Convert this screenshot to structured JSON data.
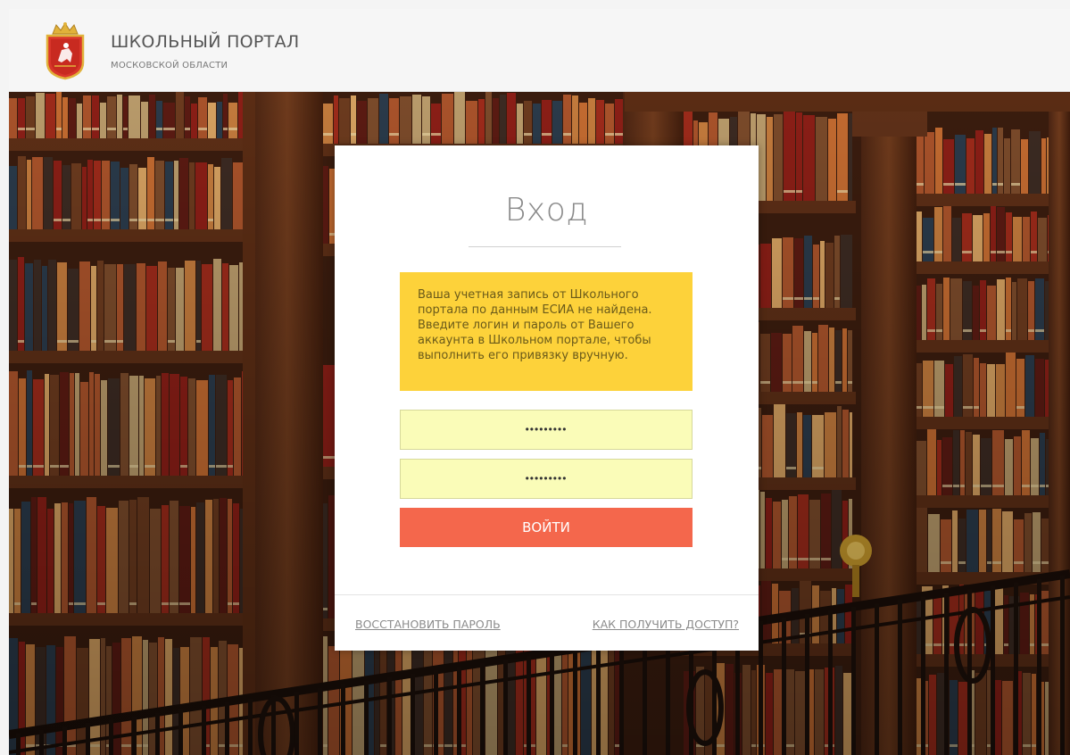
{
  "header": {
    "title": "ШКОЛЬНЫЙ ПОРТАЛ",
    "subtitle": "МОСКОВСКОЙ ОБЛАСТИ",
    "crest_icon": "moscow-oblast-coat-of-arms-icon"
  },
  "login": {
    "title": "Вход",
    "notice": "Ваша учетная запись от Школьного портала по данным ЕСИА не найдена. Введите логин и пароль от Вашего аккаунта в Школьном портале, чтобы выполнить его привязку вручную.",
    "login_value": "•••••••••",
    "password_value": "•••••••••",
    "submit_label": "ВОЙТИ",
    "restore_link": "ВОССТАНОВИТЬ ПАРОЛЬ",
    "access_link": "КАК ПОЛУЧИТЬ ДОСТУП?"
  },
  "colors": {
    "notice_bg": "#fdd23a",
    "field_bg": "#fafcb8",
    "button_bg": "#f4674c"
  }
}
